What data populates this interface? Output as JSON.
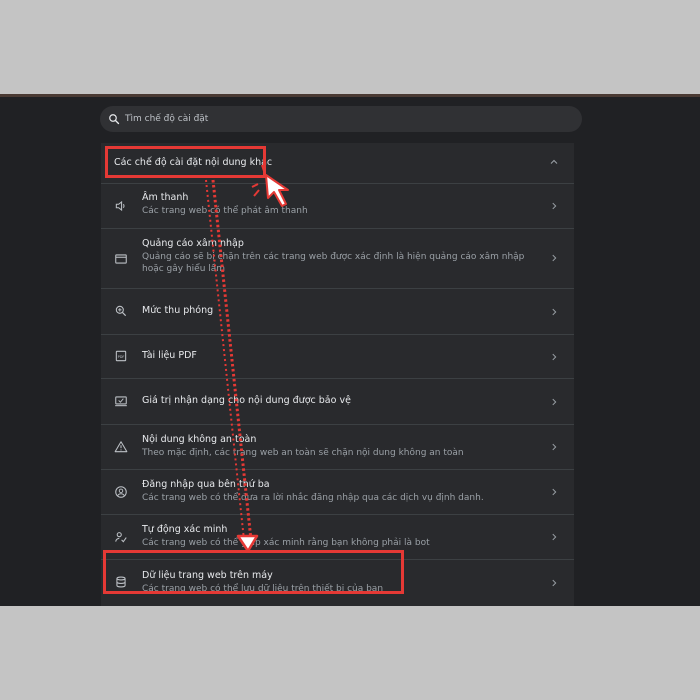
{
  "search": {
    "placeholder": "Tìm chế độ cài đặt"
  },
  "section": {
    "title": "Các chế độ cài đặt nội dung khác"
  },
  "rows": [
    {
      "title": "Âm thanh",
      "desc": "Các trang web có thể phát âm thanh",
      "icon": "speaker-icon"
    },
    {
      "title": "Quảng cáo xâm nhập",
      "desc": "Quảng cáo sẽ bị chặn trên các trang web được xác định là hiện quảng cáo xâm nhập hoặc gây hiểu lầm",
      "icon": "browser-window-icon"
    },
    {
      "title": "Mức thu phóng",
      "desc": "",
      "icon": "zoom-icon"
    },
    {
      "title": "Tài liệu PDF",
      "desc": "",
      "icon": "pdf-icon"
    },
    {
      "title": "Giá trị nhận dạng cho nội dung được bảo vệ",
      "desc": "",
      "icon": "protected-content-icon"
    },
    {
      "title": "Nội dung không an toàn",
      "desc": "Theo mặc định, các trang web an toàn sẽ chặn nội dung không an toàn",
      "icon": "warning-icon"
    },
    {
      "title": "Đăng nhập qua bên thứ ba",
      "desc": "Các trang web có thể đưa ra lời nhắc đăng nhập qua các dịch vụ định danh.",
      "icon": "account-circle-icon"
    },
    {
      "title": "Tự động xác minh",
      "desc": "Các trang web có thể giúp xác minh rằng bạn không phải là bot",
      "icon": "person-check-icon"
    },
    {
      "title": "Dữ liệu trang web trên máy",
      "desc": "Các trang web có thể lưu dữ liệu trên thiết bị của bạn",
      "icon": "database-icon"
    }
  ],
  "colors": {
    "highlight": "#e53935",
    "background": "#202124",
    "panel": "#292a2d"
  }
}
